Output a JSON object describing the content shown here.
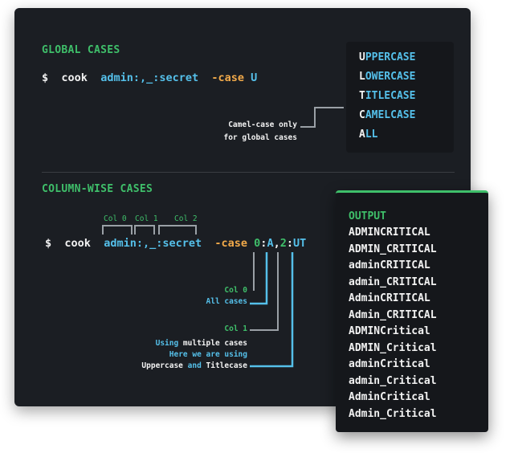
{
  "global": {
    "heading": "GLOBAL CASES",
    "prompt": "$",
    "cmd": "cook",
    "pattern": "admin:,_:secret",
    "flag": "-case",
    "flag_value": "U",
    "cases": [
      {
        "first": "U",
        "rest": "PPERCASE"
      },
      {
        "first": "L",
        "rest": "OWERCASE"
      },
      {
        "first": "T",
        "rest": "ITLECASE"
      },
      {
        "first": "C",
        "rest": "AMELCASE"
      },
      {
        "first": "A",
        "rest": "LL"
      }
    ],
    "note_line1": "Camel-case only",
    "note_line2": "for global cases"
  },
  "column": {
    "heading": "COLUMN-WISE CASES",
    "col0": "Col 0",
    "col1": "Col 1",
    "col2": "Col 2",
    "prompt": "$",
    "cmd": "cook",
    "pattern": "admin:,_:secret",
    "flag": "-case",
    "value_0": "0",
    "value_colon1": ":",
    "value_A": "A",
    "value_comma": ",",
    "value_2": "2",
    "value_colon2": ":",
    "value_UT": "UT",
    "ann_col0": "Col 0",
    "ann_allcases": "All cases",
    "ann_col1": "Col 1",
    "ann_using": "Using",
    "ann_multiple": " multiple cases",
    "ann_here": "Here we are using",
    "ann_upper": "Uppercase",
    "ann_and": " and ",
    "ann_title": "Titlecase"
  },
  "output": {
    "title": "OUTPUT",
    "items": [
      "ADMINCRITICAL",
      "ADMIN_CRITICAL",
      "adminCRITICAL",
      "admin_CRITICAL",
      "AdminCRITICAL",
      "Admin_CRITICAL",
      "ADMINCritical",
      "ADMIN_Critical",
      "adminCritical",
      "admin_Critical",
      "AdminCritical",
      "Admin_Critical"
    ]
  },
  "colors": {
    "background": "#1b1e23",
    "green": "#3fbf6a",
    "blue": "#55c0ea",
    "orange": "#f0a94a",
    "white": "#f2f2f2"
  }
}
